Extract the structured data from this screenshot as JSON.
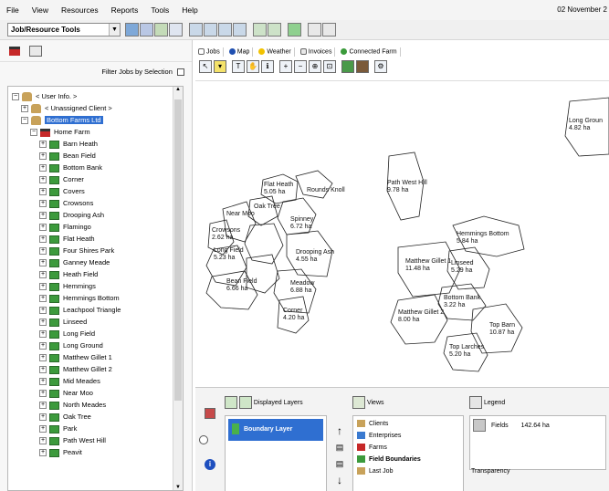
{
  "menu": {
    "items": [
      "File",
      "View",
      "Resources",
      "Reports",
      "Tools",
      "Help"
    ],
    "date": "02 November 2"
  },
  "toolbar": {
    "selector_value": "Job/Resource Tools"
  },
  "left_panel": {
    "filter_label": "Filter Jobs by Selection",
    "tree": {
      "root": "< User Info. >",
      "unassigned": "< Unassigned Client >",
      "client": "Bottom Farms Ltd",
      "farm": "Home Farm",
      "fields": [
        "Barn Heath",
        "Bean Field",
        "Bottom Bank",
        "Corner",
        "Covers",
        "Crowsons",
        "Drooping Ash",
        "Flamingo",
        "Flat Heath",
        "Four Shires Park",
        "Ganney Meade",
        "Heath Field",
        "Hemmings",
        "Hemmings Bottom",
        "Leachpool Triangle",
        "Linseed",
        "Long Field",
        "Long Ground",
        "Matthew Gillet 1",
        "Matthew Gillet 2",
        "Mid Meades",
        "Near Moo",
        "North Meades",
        "Oak Tree",
        "Park",
        "Path West Hill",
        "Peavit"
      ]
    }
  },
  "tabs": {
    "items": [
      "Jobs",
      "Map",
      "Weather",
      "Invoices",
      "Connected Farm"
    ]
  },
  "map": {
    "labels": [
      {
        "text": "Long Groun",
        "sub": "4.82 ha"
      },
      {
        "text": "Path West Hill",
        "sub": "9.78 ha"
      },
      {
        "text": "Flat Heath",
        "sub": "5.05 ha"
      },
      {
        "text": "Hemmings Bottom",
        "sub": "5.84 ha"
      },
      {
        "text": "Matthew Gillet 1",
        "sub": "11.48 ha"
      },
      {
        "text": "Linseed",
        "sub": "5.29 ha"
      },
      {
        "text": "Bottom Bank",
        "sub": "3.22 ha"
      },
      {
        "text": "Matthew Gillet 2",
        "sub": "8.00 ha"
      },
      {
        "text": "Top Barn",
        "sub": "10.87 ha"
      },
      {
        "text": "Top Larches",
        "sub": "5.20 ha"
      },
      {
        "text": "Bean Field",
        "sub": "6.66 ha"
      },
      {
        "text": "Meadow",
        "sub": "6.88 ha"
      },
      {
        "text": "Corner",
        "sub": "4.20 ha"
      },
      {
        "text": "Oak Tree",
        "sub": ""
      },
      {
        "text": "Spinney",
        "sub": "6.72 ha"
      },
      {
        "text": "Drooping Ash",
        "sub": "4.55 ha"
      },
      {
        "text": "Crowsons",
        "sub": "2.62 ha"
      },
      {
        "text": "Long Field",
        "sub": "5.23 ha"
      },
      {
        "text": "Near Moo",
        "sub": ""
      },
      {
        "text": "Rounds Knoll",
        "sub": ""
      }
    ]
  },
  "bottom": {
    "layers_title": "Displayed Layers",
    "boundary_layer": "Boundary Layer",
    "views_title": "Views",
    "views_items": [
      "Clients",
      "Enterprises",
      "Farms",
      "Field Boundaries",
      "Last Job"
    ],
    "legend_title": "Legend",
    "legend_fields_label": "Fields",
    "legend_fields_value": "142.64 ha",
    "transparency_label": "Transparency"
  }
}
